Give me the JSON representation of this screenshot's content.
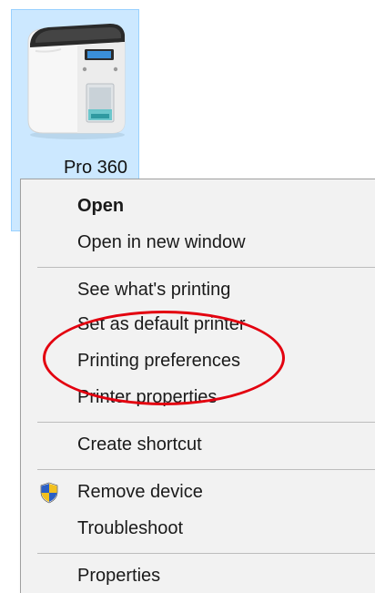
{
  "desktop_icon": {
    "label": "Pro 360",
    "icon": "card-printer-icon"
  },
  "context_menu": {
    "items": [
      {
        "label": "Open",
        "bold": true
      },
      {
        "label": "Open in new window"
      },
      {
        "label": "See what's printing"
      },
      {
        "label": "Set as default printer"
      },
      {
        "label": "Printing preferences"
      },
      {
        "label": "Printer properties"
      },
      {
        "label": "Create shortcut"
      },
      {
        "label": "Remove device",
        "icon": "uac-shield-icon"
      },
      {
        "label": "Troubleshoot"
      },
      {
        "label": "Properties"
      }
    ]
  },
  "highlight": {
    "target": "Printing preferences",
    "color": "#e3000f"
  },
  "colors": {
    "selection_bg": "#cce8ff",
    "selection_border": "#99d1ff",
    "menu_bg": "#f2f2f2"
  }
}
